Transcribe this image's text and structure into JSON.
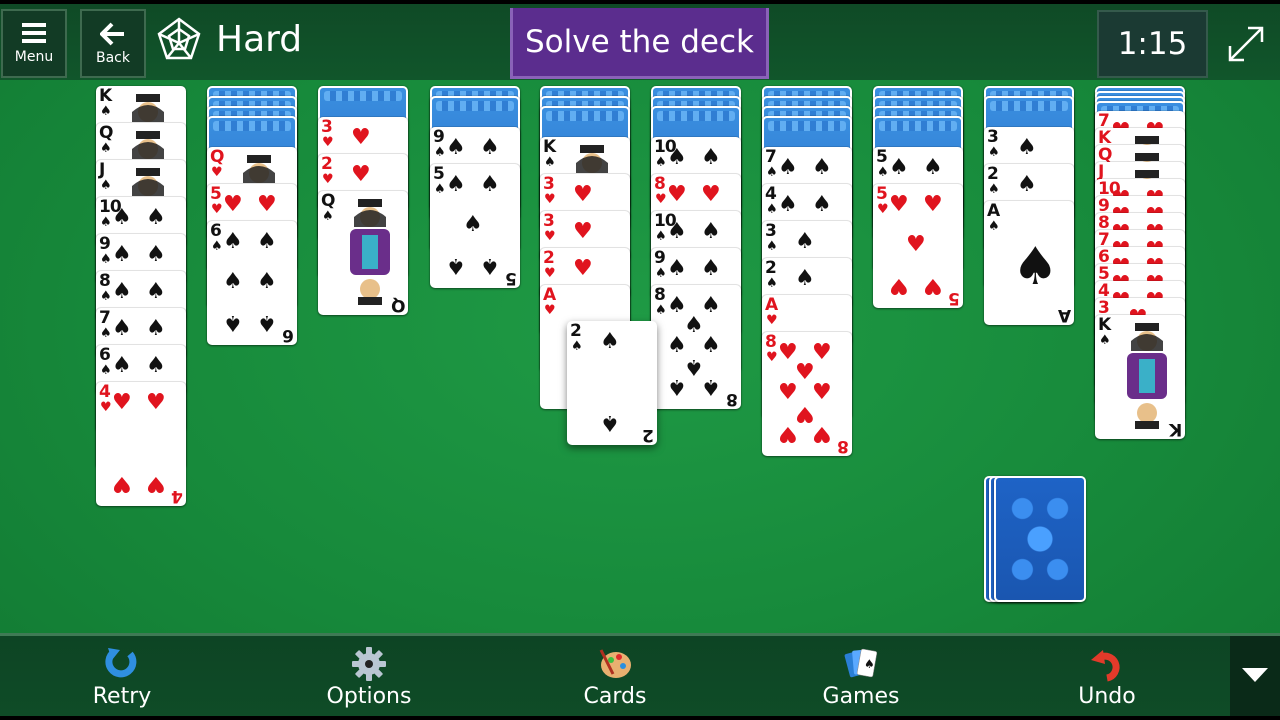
{
  "topbar": {
    "menu_label": "Menu",
    "back_label": "Back",
    "difficulty": "Hard",
    "goal": "Solve the deck",
    "timer": "1:15"
  },
  "colors": {
    "felt": "#178a3b",
    "goal_bg": "#5b2d8e",
    "timer_bg": "#1b3a33",
    "card_back": "#2a6fc7",
    "red_suit": "#e0141e"
  },
  "tableau": [
    {
      "face_down": 0,
      "cards": [
        "K♠",
        "Q♠",
        "J♠",
        "10♠",
        "9♠",
        "8♠",
        "7♠",
        "6♠",
        "4♥"
      ]
    },
    {
      "face_down": 4,
      "cards": [
        "Q♥",
        "5♥",
        "6♠"
      ]
    },
    {
      "face_down": 1,
      "cards": [
        "3♥",
        "2♥",
        "Q♠"
      ]
    },
    {
      "face_down": 2,
      "cards": [
        "9♠",
        "5♠"
      ]
    },
    {
      "face_down": 3,
      "cards": [
        "K♠",
        "3♥",
        "3♥",
        "2♥",
        "A♥"
      ]
    },
    {
      "face_down": 3,
      "cards": [
        "10♠",
        "8♥",
        "10♠",
        "9♠",
        "8♠"
      ]
    },
    {
      "face_down": 4,
      "cards": [
        "7♠",
        "4♠",
        "3♠",
        "2♠",
        "A♥",
        "8♥"
      ]
    },
    {
      "face_down": 4,
      "cards": [
        "5♠",
        "5♥"
      ]
    },
    {
      "face_down": 2,
      "cards": [
        "3♠",
        "2♠",
        "A♠"
      ]
    },
    {
      "face_down": 4,
      "cards": [
        "7♥",
        "K♥",
        "Q♥",
        "J♥",
        "10♥",
        "9♥",
        "8♥",
        "7♥",
        "6♥",
        "5♥",
        "4♥",
        "3♥",
        "K♠"
      ]
    }
  ],
  "dragged_card": "2♠",
  "stock": {
    "remaining_deals": 3
  },
  "bottombar": {
    "retry": "Retry",
    "options": "Options",
    "cards": "Cards",
    "games": "Games",
    "undo": "Undo"
  }
}
